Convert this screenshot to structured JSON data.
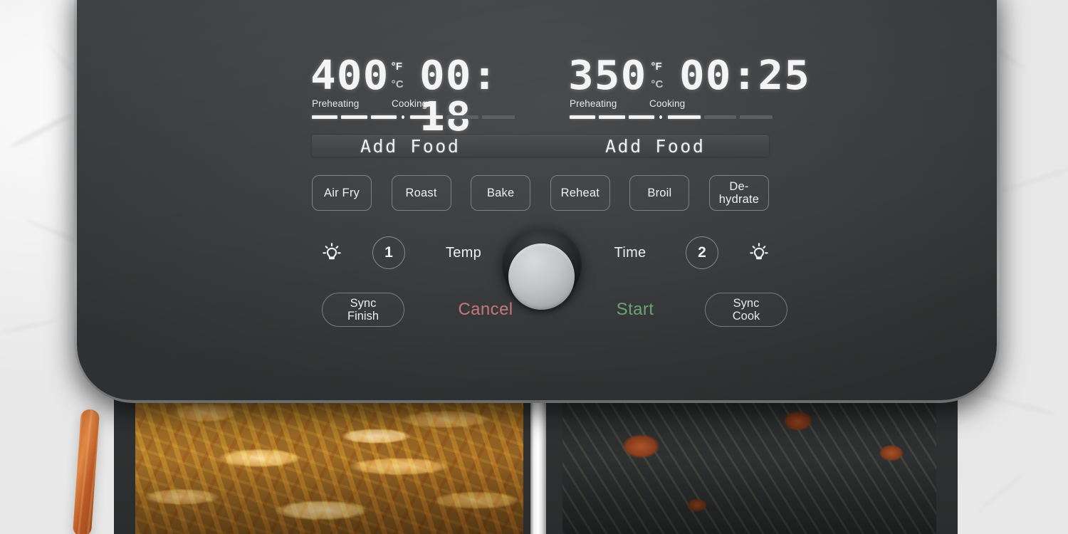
{
  "appliance": {
    "name": "Dual-Zone Air Fryer Control Panel"
  },
  "colors": {
    "panel": "#3b3d3f",
    "bezel": "#c8cacb",
    "led_text": "#f4f4f4",
    "cancel": "#c9797f",
    "start": "#6fa87a",
    "knob_cap": "#c3c5c6",
    "segment_on": "#f3f3f3",
    "segment_off": "#5b5d5e"
  },
  "zone1": {
    "temperature": "400",
    "unit_f": "°F",
    "unit_c": "°C",
    "active_unit": "°F",
    "time": "00: 18",
    "stage_preheating_label": "Preheating",
    "stage_cooking_label": "Cooking",
    "preheat_segments": [
      true,
      true,
      true
    ],
    "cook_segments": [
      true,
      false,
      false
    ],
    "add_food_label": "Add Food",
    "zone_number": "1",
    "light_icon": "lightbulb-icon"
  },
  "zone2": {
    "temperature": "350",
    "unit_f": "°F",
    "unit_c": "°C",
    "active_unit": "°F",
    "time": "00:25",
    "stage_preheating_label": "Preheating",
    "stage_cooking_label": "Cooking",
    "preheat_segments": [
      true,
      true,
      true
    ],
    "cook_segments": [
      true,
      false,
      false
    ],
    "add_food_label": "Add Food",
    "zone_number": "2",
    "light_icon": "lightbulb-icon"
  },
  "modes": [
    {
      "id": "air-fry",
      "label": "Air Fry"
    },
    {
      "id": "roast",
      "label": "Roast"
    },
    {
      "id": "bake",
      "label": "Bake"
    },
    {
      "id": "reheat",
      "label": "Reheat"
    },
    {
      "id": "broil",
      "label": "Broil"
    },
    {
      "id": "dehydrate",
      "label": "De-\nhydrate"
    }
  ],
  "controls": {
    "temp_label": "Temp",
    "time_label": "Time",
    "knob": "rotary-dial"
  },
  "actions": {
    "sync_finish": "Sync\nFinish",
    "cancel": "Cancel",
    "start": "Start",
    "sync_cook": "Sync\nCook"
  },
  "baskets": {
    "left_contents": "french-fries",
    "right_contents": "brussels-sprouts-with-bacon"
  }
}
